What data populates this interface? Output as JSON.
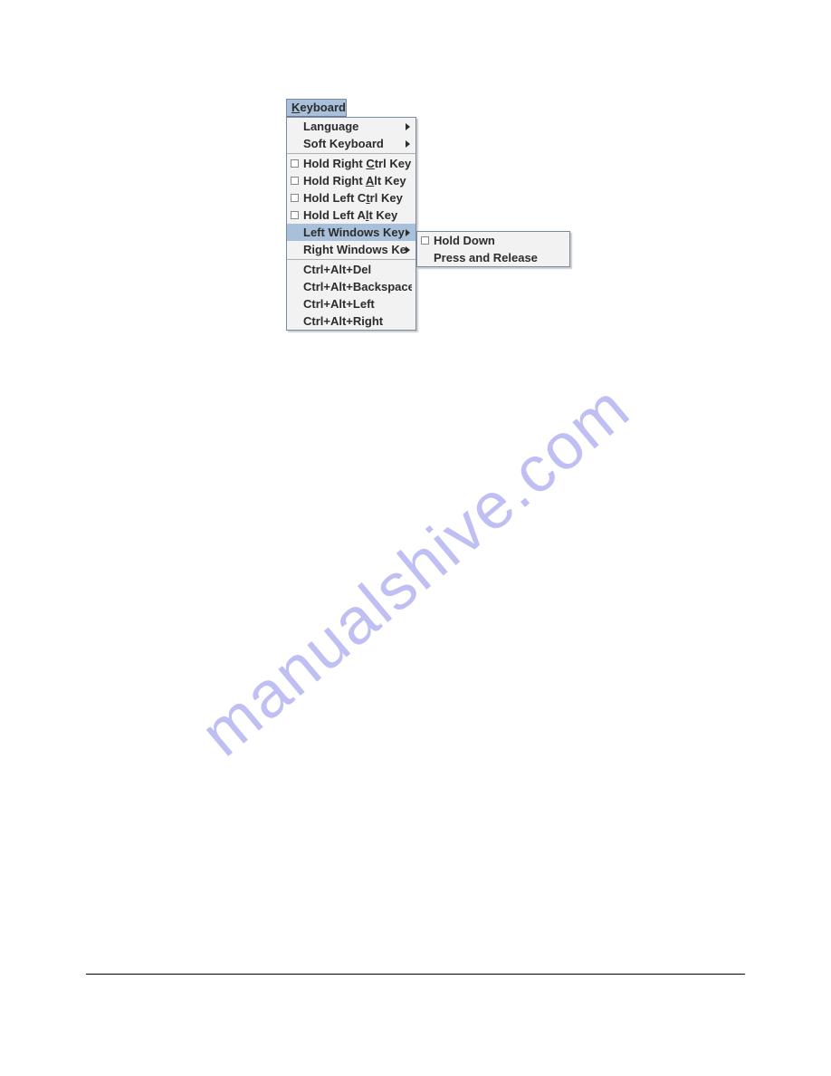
{
  "watermark": "manualshive.com",
  "menubar": {
    "keyboard_label_pre": "K",
    "keyboard_label_rest": "eyboard"
  },
  "main_menu": {
    "language": "Language",
    "soft_keyboard": "Soft Keyboard",
    "hold_right_ctrl_pre": "Hold Right ",
    "hold_right_ctrl_mn": "C",
    "hold_right_ctrl_post": "trl Key",
    "hold_right_alt_pre": "Hold Right ",
    "hold_right_alt_mn": "A",
    "hold_right_alt_post": "lt Key",
    "hold_left_ctrl_pre": "Hold Left C",
    "hold_left_ctrl_mn": "t",
    "hold_left_ctrl_post": "rl Key",
    "hold_left_alt_pre": "Hold Left A",
    "hold_left_alt_mn": "l",
    "hold_left_alt_post": "t Key",
    "left_windows": "Left Windows Key",
    "right_windows": "Right Windows Key",
    "ctrl_alt_del": "Ctrl+Alt+Del",
    "ctrl_alt_backspace": "Ctrl+Alt+Backspace",
    "ctrl_alt_left": "Ctrl+Alt+Left",
    "ctrl_alt_right": "Ctrl+Alt+Right"
  },
  "sub_menu": {
    "hold_down": "Hold Down",
    "press_release": "Press and Release"
  }
}
